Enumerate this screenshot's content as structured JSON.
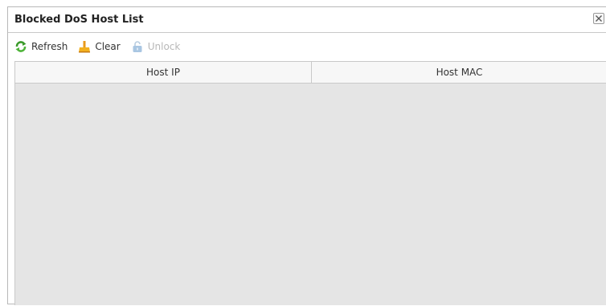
{
  "dialog": {
    "title": "Blocked DoS Host List"
  },
  "toolbar": {
    "refresh_label": "Refresh",
    "clear_label": "Clear",
    "unlock_label": "Unlock",
    "unlock_enabled": false,
    "icons": {
      "refresh": "refresh-icon",
      "clear": "broom-icon",
      "unlock": "unlock-icon"
    }
  },
  "table": {
    "columns": [
      "Host IP",
      "Host MAC"
    ],
    "rows": []
  }
}
